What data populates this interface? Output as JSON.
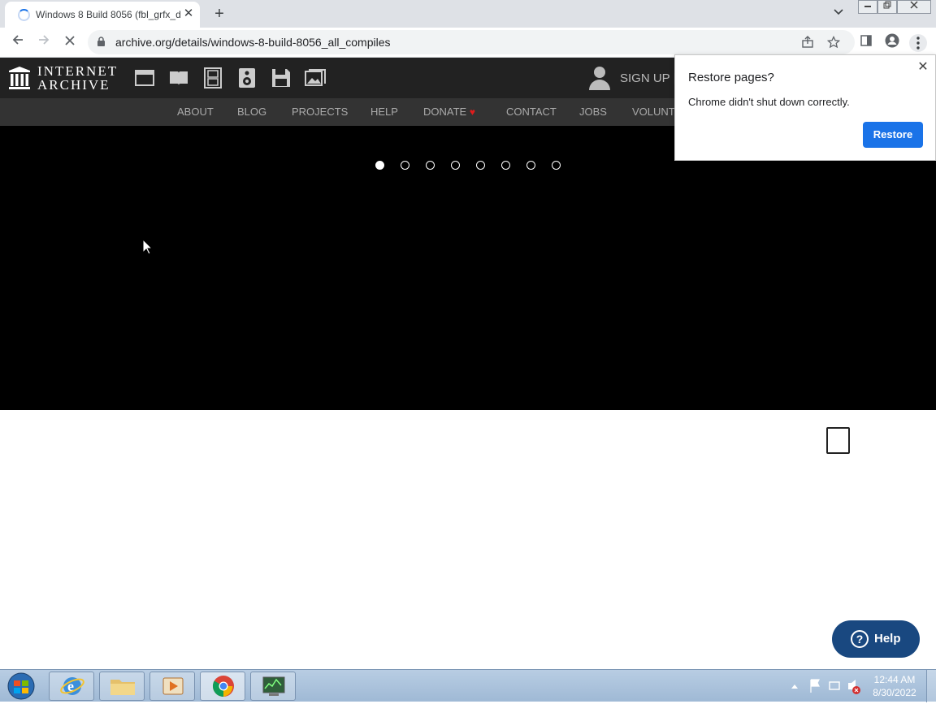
{
  "browser": {
    "tab_title": "Windows 8 Build 8056 (fbl_grfx_d",
    "tab_close": "✕",
    "new_tab": "+",
    "tab_search": "⌄",
    "url": "archive.org/details/windows-8-build-8056_all_compiles"
  },
  "ia": {
    "logo_line1": "INTERNET",
    "logo_line2": "ARCHIVE",
    "signup": "SIGN UP |",
    "nav": [
      "ABOUT",
      "BLOG",
      "PROJECTS",
      "HELP",
      "DONATE",
      "CONTACT",
      "JOBS",
      "VOLUNTE"
    ],
    "donate_heart": "♥"
  },
  "carousel": {
    "dot_count": 8,
    "active_index": 0
  },
  "restore_popup": {
    "title": "Restore pages?",
    "message": "Chrome didn't shut down correctly.",
    "button": "Restore",
    "close": "✕"
  },
  "help_button": {
    "label": "Help",
    "icon": "?"
  },
  "taskbar": {
    "time": "12:44 AM",
    "date": "8/30/2022"
  },
  "colors": {
    "accent": "#1a73e8",
    "ia_header": "#222222",
    "help": "#194880"
  }
}
